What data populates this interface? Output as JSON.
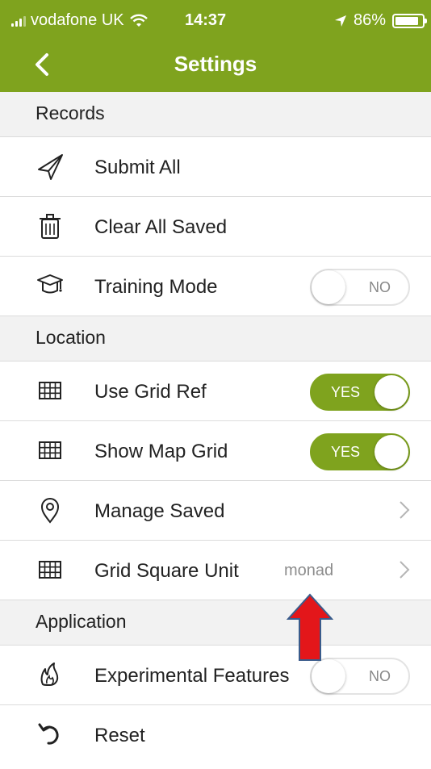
{
  "status_bar": {
    "carrier": "vodafone UK",
    "time": "14:37",
    "battery": "86%",
    "battery_level": 0.86
  },
  "nav": {
    "title": "Settings"
  },
  "sections": {
    "records": "Records",
    "location": "Location",
    "application": "Application"
  },
  "rows": {
    "submit_all": "Submit All",
    "clear_all_saved": "Clear All Saved",
    "training_mode": {
      "label": "Training Mode",
      "toggle": "NO",
      "on": false
    },
    "use_grid_ref": {
      "label": "Use Grid Ref",
      "toggle": "YES",
      "on": true
    },
    "show_map_grid": {
      "label": "Show Map Grid",
      "toggle": "YES",
      "on": true
    },
    "manage_saved": "Manage Saved",
    "grid_square_unit": {
      "label": "Grid Square Unit",
      "value": "monad"
    },
    "experimental_features": {
      "label": "Experimental Features",
      "toggle": "NO",
      "on": false
    },
    "reset": "Reset"
  },
  "colors": {
    "accent": "#7fa31e",
    "annotation_arrow": "#e3161a"
  }
}
